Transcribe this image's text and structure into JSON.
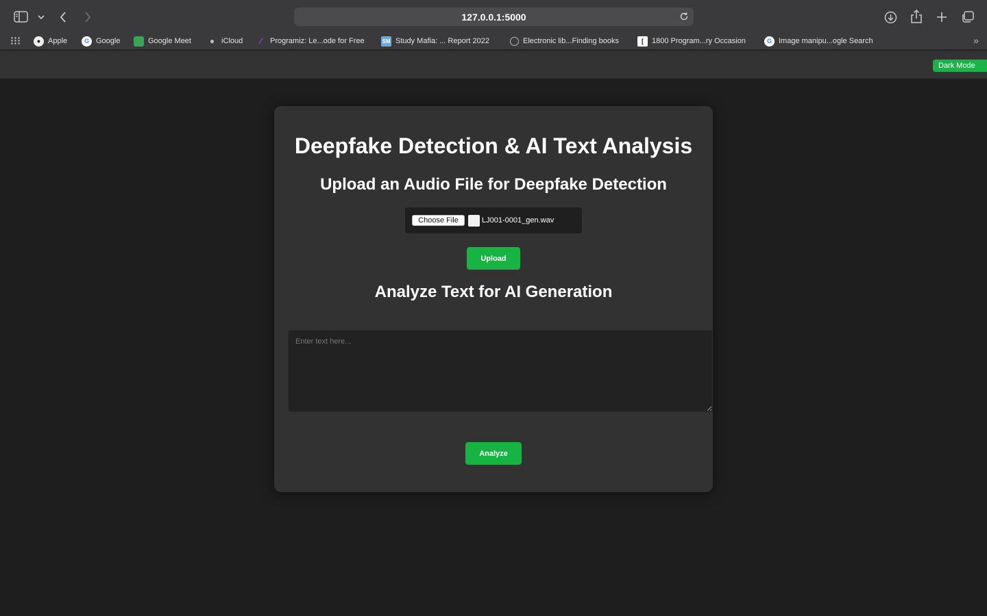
{
  "browser": {
    "url": "127.0.0.1:5000",
    "bookmarks": [
      {
        "label": "Apple",
        "icon": "apple-icon"
      },
      {
        "label": "Google",
        "icon": "google-icon"
      },
      {
        "label": "Google Meet",
        "icon": "google-meet-icon"
      },
      {
        "label": "iCloud",
        "icon": "apple-icon"
      },
      {
        "label": "Programiz: Le...ode for Free",
        "icon": "programiz-icon"
      },
      {
        "label": "Study Mafia: ... Report 2022",
        "icon": "study-mafia-icon"
      },
      {
        "label": "Electronic lib...Finding books",
        "icon": "globe-icon"
      },
      {
        "label": "1800 Program...ry Occasion",
        "icon": "bracket-icon"
      },
      {
        "label": "Image manipu...ogle Search",
        "icon": "google-icon"
      }
    ]
  },
  "header": {
    "dark_mode_label": "Dark Mode"
  },
  "main": {
    "title": "Deepfake Detection & AI Text Analysis",
    "upload_heading": "Upload an Audio File for Deepfake Detection",
    "choose_file_label": "Choose File",
    "file_name": "LJ001-0001_gen.wav",
    "upload_label": "Upload",
    "analyze_heading": "Analyze Text for AI Generation",
    "text_placeholder": "Enter text here...",
    "analyze_label": "Analyze"
  },
  "colors": {
    "accent_green": "#17b443",
    "background": "#1e1e1e",
    "card": "#323232"
  }
}
